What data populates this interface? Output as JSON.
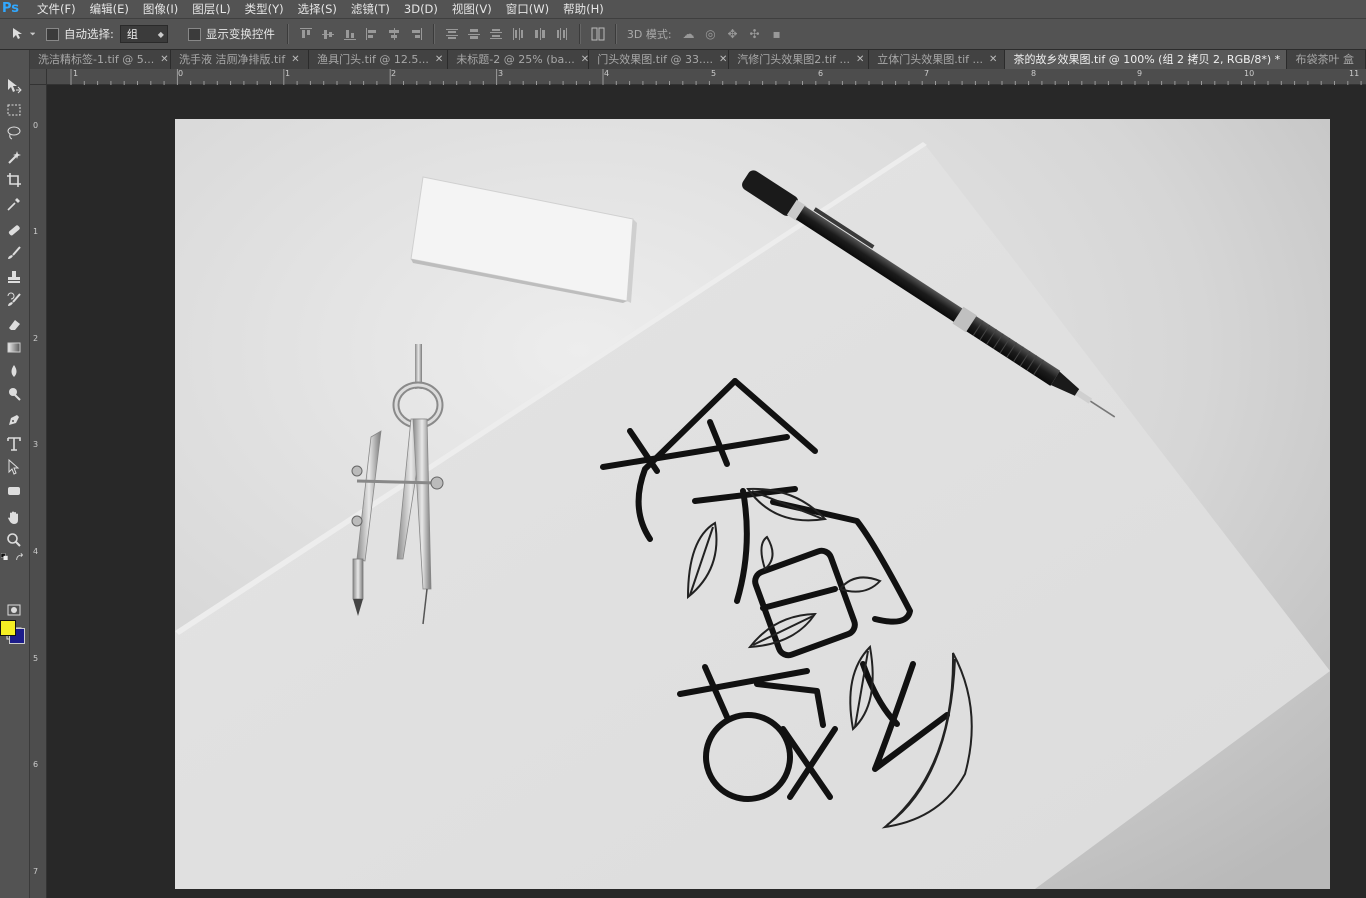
{
  "app": {
    "logo": "Ps"
  },
  "menu": [
    {
      "label": "文件(F)"
    },
    {
      "label": "编辑(E)"
    },
    {
      "label": "图像(I)"
    },
    {
      "label": "图层(L)"
    },
    {
      "label": "类型(Y)"
    },
    {
      "label": "选择(S)"
    },
    {
      "label": "滤镜(T)"
    },
    {
      "label": "3D(D)"
    },
    {
      "label": "视图(V)"
    },
    {
      "label": "窗口(W)"
    },
    {
      "label": "帮助(H)"
    }
  ],
  "options": {
    "auto_select_label": "自动选择:",
    "auto_select_value": "组",
    "show_transform_label": "显示变换控件",
    "mode_3d_label": "3D 模式:"
  },
  "tabs": [
    {
      "label": "洗洁精标签-1.tif @ 5..."
    },
    {
      "label": "洗手液  洁厕净排版.tif"
    },
    {
      "label": "渔具门头.tif @ 12.5..."
    },
    {
      "label": "未标题-2 @ 25% (ba..."
    },
    {
      "label": "门头效果图.tif @ 33...."
    },
    {
      "label": "汽修门头效果图2.tif ..."
    },
    {
      "label": "立体门头效果图.tif ..."
    },
    {
      "label": "茶的故乡效果图.tif @ 100% (组 2 拷贝 2, RGB/8*) *",
      "active": true
    },
    {
      "label": "布袋茶叶 盒"
    }
  ],
  "ruler_top": [
    "1",
    "0",
    "1",
    "2",
    "3",
    "4",
    "5",
    "6",
    "7",
    "8",
    "9",
    "10",
    "11"
  ],
  "ruler_left": [
    "0",
    "1",
    "2",
    "3",
    "4",
    "5",
    "6",
    "7"
  ],
  "colors": {
    "foreground": "#f5ef23",
    "background": "#1c1c8a",
    "accent": "#31a8ff"
  }
}
